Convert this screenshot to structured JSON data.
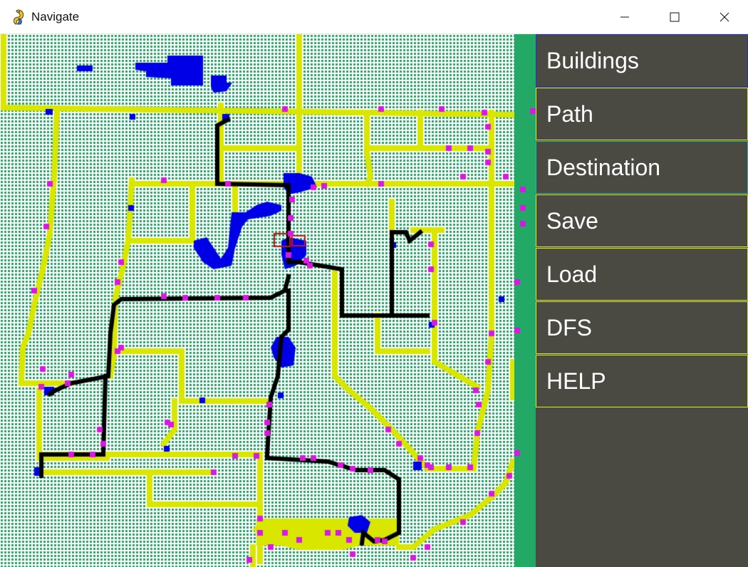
{
  "window": {
    "title": "Navigate",
    "icon": "pygame-snake-icon",
    "controls": [
      "minimize-icon",
      "maximize-icon",
      "close-icon"
    ]
  },
  "menu": {
    "items": [
      {
        "label": "Buildings"
      },
      {
        "label": "Path"
      },
      {
        "label": "Destination"
      },
      {
        "label": "Save"
      },
      {
        "label": "Load"
      },
      {
        "label": "DFS"
      },
      {
        "label": "HELP"
      }
    ]
  },
  "colors": {
    "grid_background": "#ffffff",
    "grid_cell": "#2e9a6a",
    "road": "#d8e600",
    "building": "#0000e6",
    "node": "#d61be0",
    "path": "#000000",
    "selected": "#c0181e",
    "divider": "#23a866",
    "panel": "#4a4a43",
    "button_border": "#d8e82a"
  }
}
